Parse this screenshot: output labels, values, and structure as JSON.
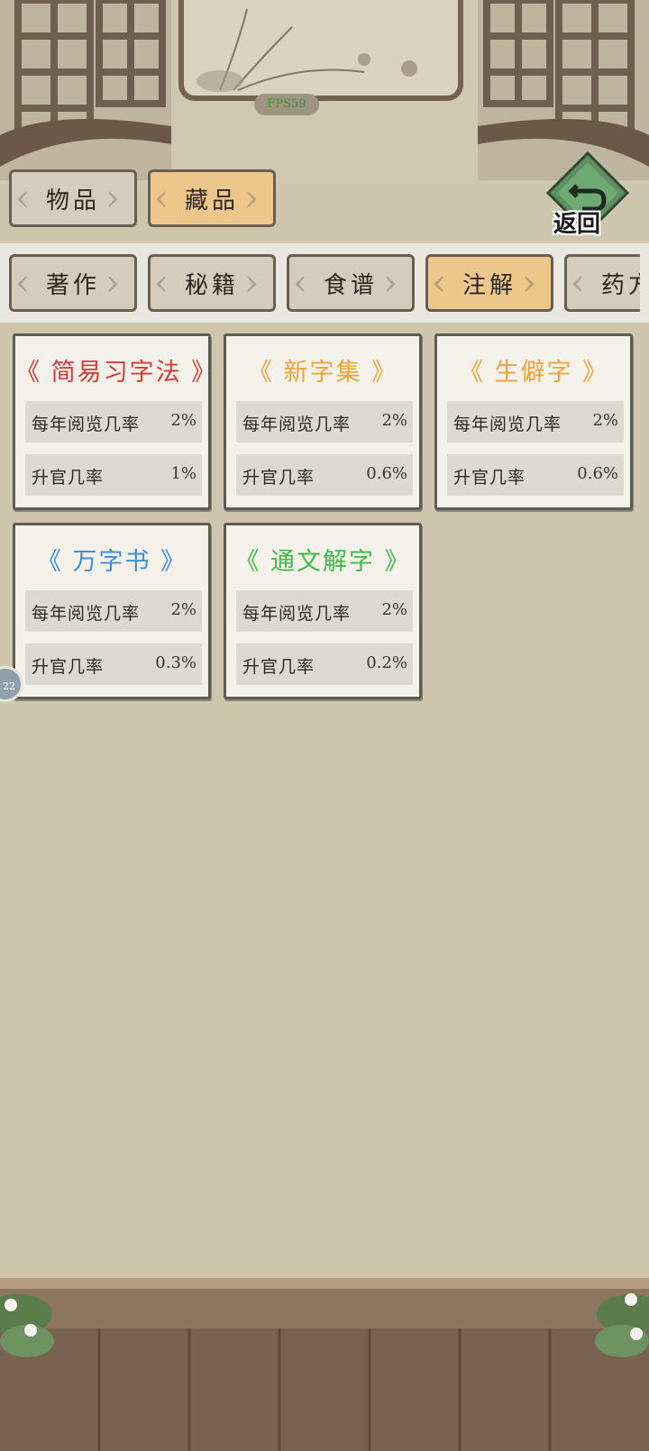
{
  "fps": "FPS59",
  "main_tabs": [
    {
      "label": "物品",
      "active": false
    },
    {
      "label": "藏品",
      "active": true
    }
  ],
  "back_label": "返回",
  "sub_tabs": [
    {
      "label": "著作",
      "active": false
    },
    {
      "label": "秘籍",
      "active": false
    },
    {
      "label": "食谱",
      "active": false
    },
    {
      "label": "注解",
      "active": true
    },
    {
      "label": "药方",
      "active": false
    }
  ],
  "side_bubble": "22",
  "row_labels": {
    "read": "每年阅览几率",
    "promote": "升官几率"
  },
  "items": [
    {
      "title": "《 简易习字法 》",
      "color": "#d83a35",
      "read": "2%",
      "promote": "1%"
    },
    {
      "title": "《 新字集 》",
      "color": "#eda53a",
      "read": "2%",
      "promote": "0.6%"
    },
    {
      "title": "《 生僻字 》",
      "color": "#eda53a",
      "read": "2%",
      "promote": "0.6%"
    },
    {
      "title": "《 万字书 》",
      "color": "#3f8ed2",
      "read": "2%",
      "promote": "0.3%"
    },
    {
      "title": "《 通文解字 》",
      "color": "#3fbb4a",
      "read": "2%",
      "promote": "0.2%"
    }
  ]
}
